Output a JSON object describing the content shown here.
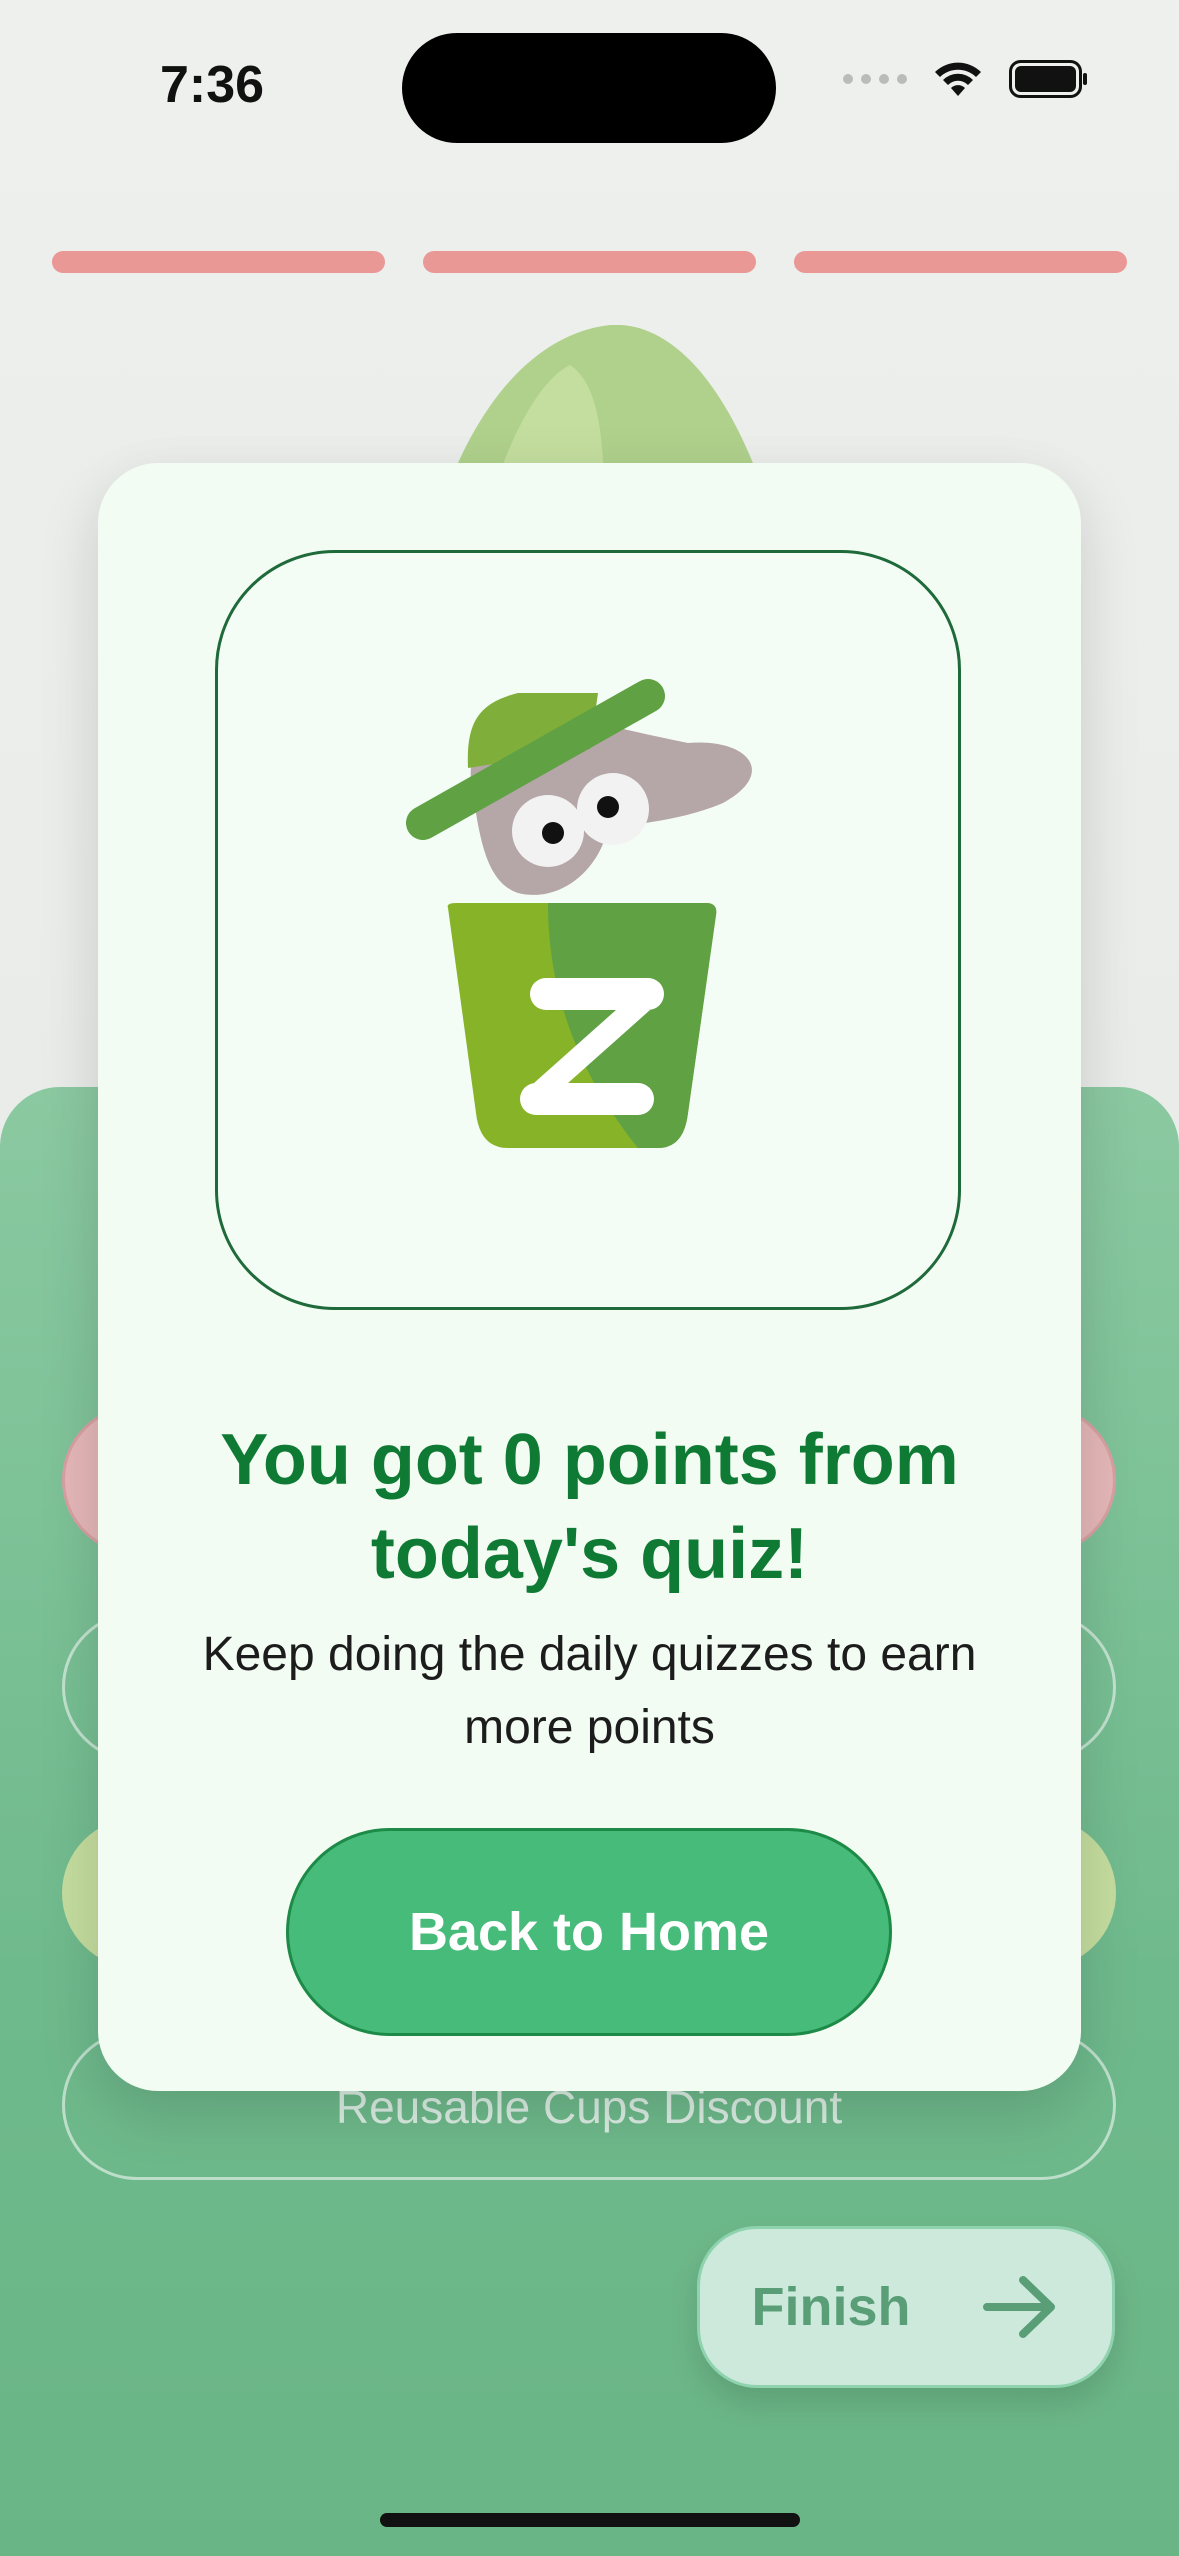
{
  "status_bar": {
    "time": "7:36"
  },
  "quiz": {
    "progress_segments": 3,
    "answer_4": "Reusable Cups Discount",
    "finish_label": "Finish"
  },
  "modal": {
    "title": "You got 0 points from today's quiz!",
    "subtitle": "Keep doing the daily quizzes to earn more points",
    "button_label": "Back to Home"
  },
  "colors": {
    "accent_green": "#47bb7a",
    "title_green": "#0f7a34",
    "progress_pink": "#ea9896"
  }
}
